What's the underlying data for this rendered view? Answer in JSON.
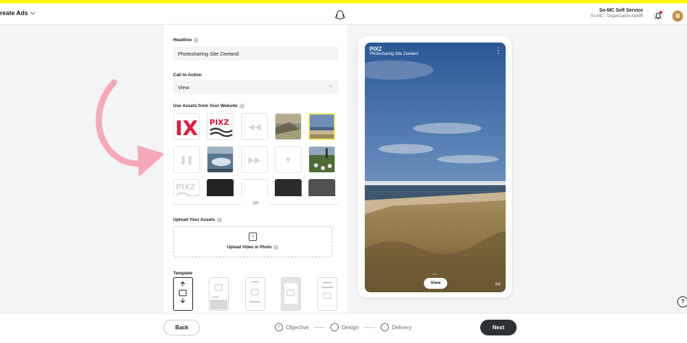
{
  "colors": {
    "accent": "#fffc00",
    "primary_button": "#2e3133",
    "arrow": "#f6a8b8",
    "notification": "#e1143d",
    "selected_asset_border": "#f7e35b"
  },
  "header": {
    "title": "reate Ads",
    "logo_icon": "ghost-icon",
    "account_name": "So-MC Self Service",
    "account_role": "So-MC - Organization Admin"
  },
  "form": {
    "headline_label": "Headline",
    "headline_value": "Photosharing Site Zeeland",
    "cta_label": "Call to Action",
    "cta_value": "View",
    "assets_label": "Use Assets from Your Website",
    "or_text": "OR",
    "upload_label": "Upload Your Assets",
    "upload_button": "Upload Video or Photo",
    "template_label": "Template"
  },
  "preview": {
    "brand": "PIXZ",
    "headline": "Photosharing Site Zeeland",
    "cta": "View",
    "ad_tag": "Ad"
  },
  "help": {
    "label": "?"
  },
  "footer": {
    "back": "Back",
    "steps": [
      {
        "label": "Objective",
        "status": "complete"
      },
      {
        "label": "Design",
        "status": "current"
      },
      {
        "label": "Delivery",
        "status": "upcoming"
      }
    ],
    "next": "Next"
  }
}
